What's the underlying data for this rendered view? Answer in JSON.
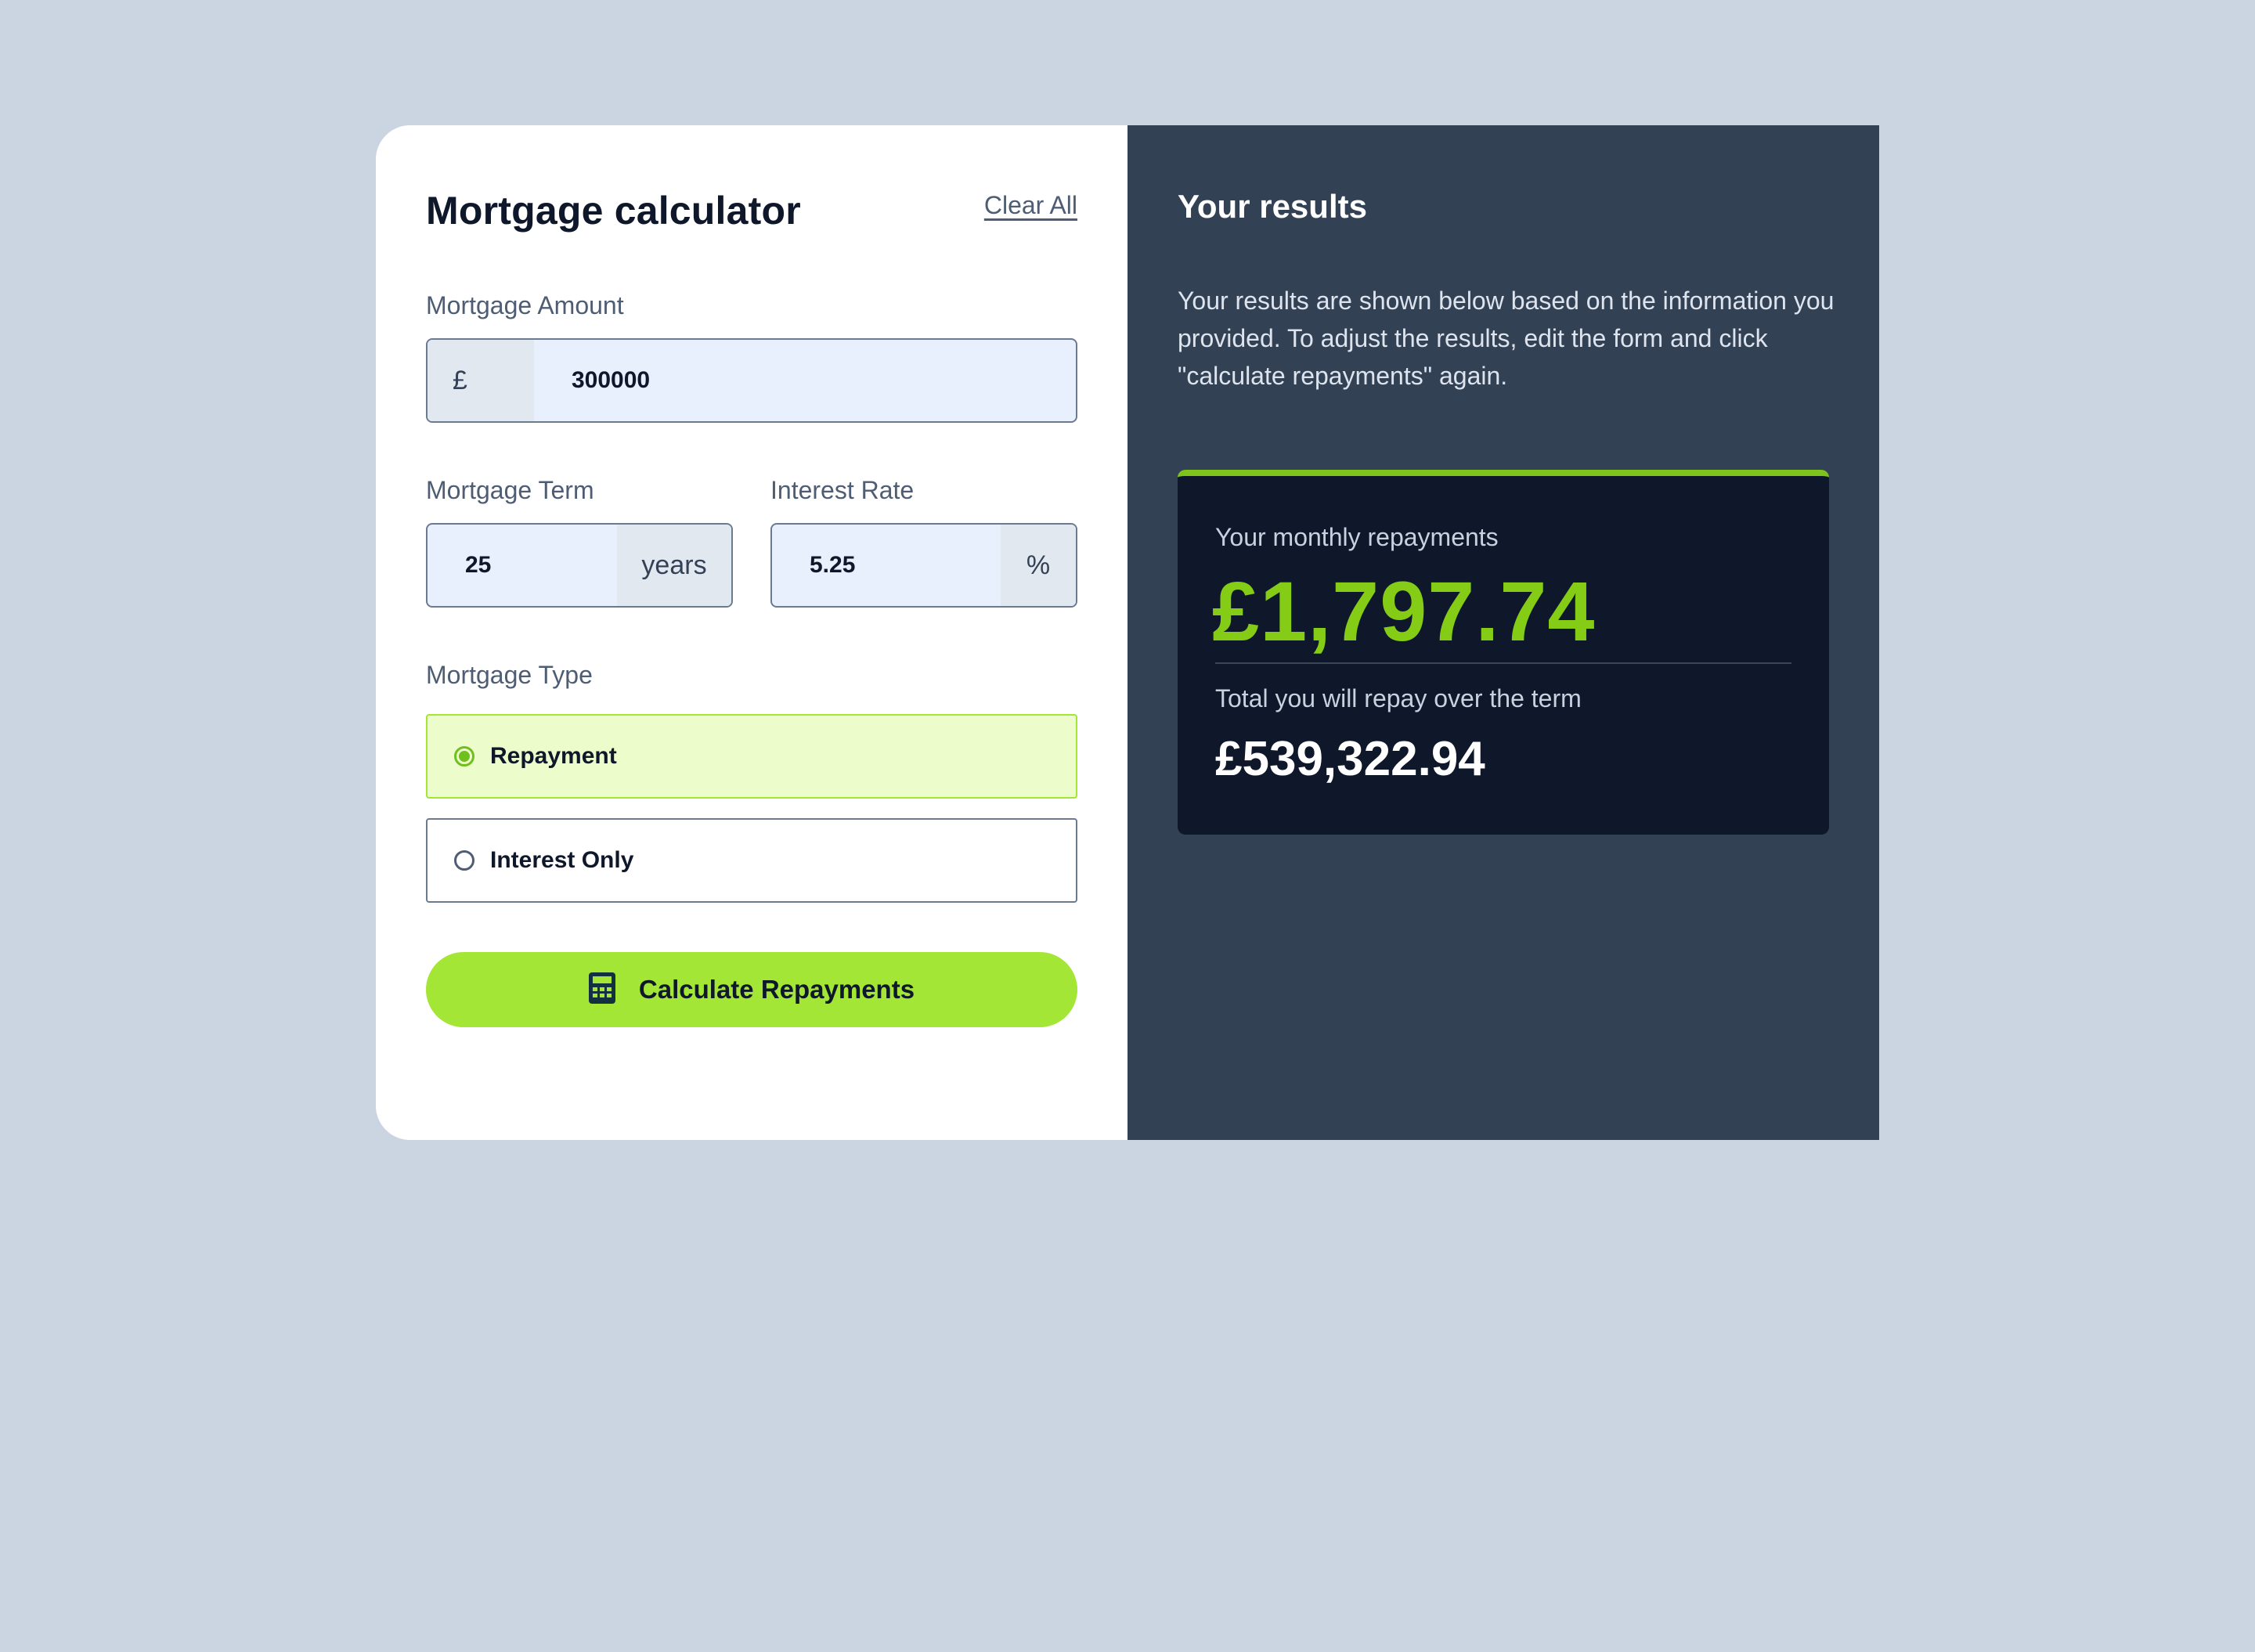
{
  "calculator": {
    "title": "Mortgage calculator",
    "clear_all": "Clear All",
    "amount": {
      "label": "Mortgage Amount",
      "prefix": "£",
      "value": "300000"
    },
    "term": {
      "label": "Mortgage Term",
      "value": "25",
      "suffix": "years"
    },
    "rate": {
      "label": "Interest Rate",
      "value": "5.25",
      "suffix": "%"
    },
    "type": {
      "label": "Mortgage Type",
      "options": [
        {
          "label": "Repayment",
          "selected": true
        },
        {
          "label": "Interest Only",
          "selected": false
        }
      ]
    },
    "calculate_button": {
      "label": "Calculate Repayments",
      "icon": "calculator-icon"
    }
  },
  "results": {
    "title": "Your results",
    "description": "Your results are shown below based on the information you provided. To adjust the results, edit the form and click \"calculate repayments\" again.",
    "monthly_label": "Your monthly repayments",
    "monthly_value": "£1,797.74",
    "total_label": "Total you will repay over the term",
    "total_value": "£539,322.94"
  },
  "colors": {
    "page_bg": "#cbd5e1",
    "accent_lime": "#a3e635",
    "results_bg": "#334155",
    "result_card_bg": "#0f172a",
    "monthly_green": "#84cc16"
  }
}
